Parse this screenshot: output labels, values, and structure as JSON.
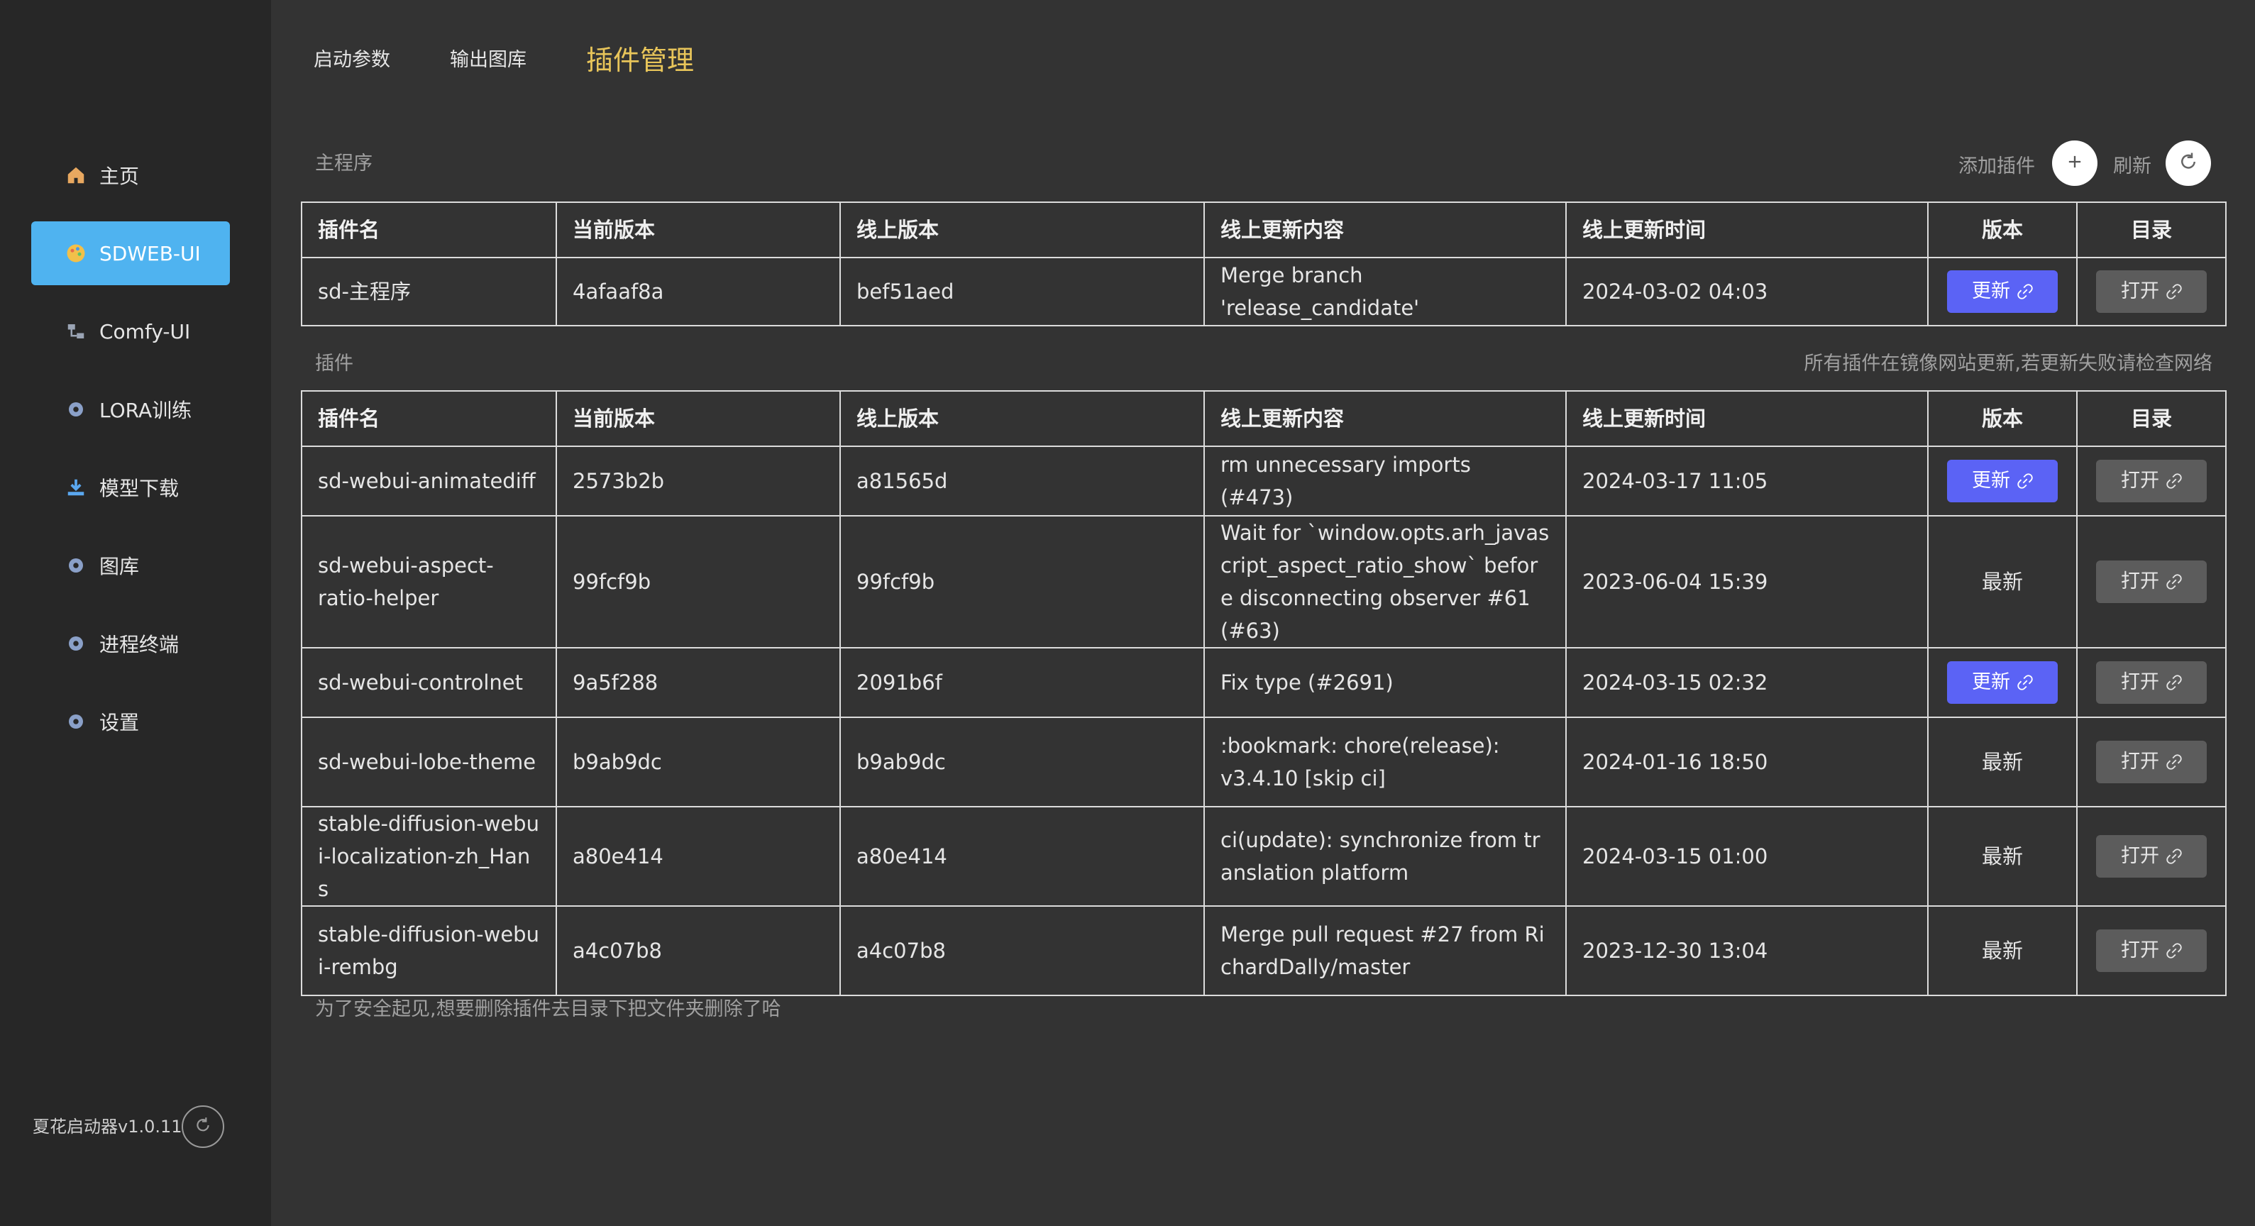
{
  "tabs": [
    {
      "label": "启动参数"
    },
    {
      "label": "输出图库"
    },
    {
      "label": "插件管理"
    }
  ],
  "sidebar": {
    "items": [
      {
        "label": "主页",
        "icon": "home-icon"
      },
      {
        "label": "SDWEB-UI",
        "icon": "palette-icon"
      },
      {
        "label": "Comfy-UI",
        "icon": "network-icon"
      },
      {
        "label": "LORA训练",
        "icon": "gear-icon"
      },
      {
        "label": "模型下载",
        "icon": "download-icon"
      },
      {
        "label": "图库",
        "icon": "gear-icon"
      },
      {
        "label": "进程终端",
        "icon": "gear-icon"
      },
      {
        "label": "设置",
        "icon": "gear-icon"
      }
    ],
    "version": "夏花启动器v1.0.11"
  },
  "main_section": {
    "title": "主程序",
    "add_label": "添加插件",
    "refresh_label": "刷新",
    "columns": [
      "插件名",
      "当前版本",
      "线上版本",
      "线上更新内容",
      "线上更新时间",
      "版本",
      "目录"
    ],
    "row": {
      "name": "sd-主程序",
      "current": "4afaaf8a",
      "online": "bef51aed",
      "content": "Merge branch 'release_candidate'",
      "time": "2024-03-02 04:03",
      "status": "更新",
      "open": "打开"
    }
  },
  "plugin_section": {
    "title": "插件",
    "note": "所有插件在镜像网站更新,若更新失败请检查网络",
    "columns": [
      "插件名",
      "当前版本",
      "线上版本",
      "线上更新内容",
      "线上更新时间",
      "版本",
      "目录"
    ],
    "rows": [
      {
        "name": "sd-webui-animatediff",
        "current": "2573b2b",
        "online": "a81565d",
        "content": "rm unnecessary imports (#473)",
        "time": "2024-03-17 11:05",
        "status": "更新",
        "open": "打开"
      },
      {
        "name": "sd-webui-aspect-ratio-helper",
        "current": "99fcf9b",
        "online": "99fcf9b",
        "content": "Wait for `window.opts.arh_javascript_aspect_ratio_show` before disconnecting observer #61 (#63)",
        "time": "2023-06-04 15:39",
        "status": "最新",
        "open": "打开"
      },
      {
        "name": "sd-webui-controlnet",
        "current": "9a5f288",
        "online": "2091b6f",
        "content": "Fix type (#2691)",
        "time": "2024-03-15 02:32",
        "status": "更新",
        "open": "打开"
      },
      {
        "name": "sd-webui-lobe-theme",
        "current": "b9ab9dc",
        "online": "b9ab9dc",
        "content": ":bookmark: chore(release): v3.4.10 [skip ci]",
        "time": "2024-01-16 18:50",
        "status": "最新",
        "open": "打开"
      },
      {
        "name": "stable-diffusion-webui-localization-zh_Hans",
        "current": "a80e414",
        "online": "a80e414",
        "content": "ci(update): synchronize from translation platform",
        "time": "2024-03-15 01:00",
        "status": "最新",
        "open": "打开"
      },
      {
        "name": "stable-diffusion-webui-rembg",
        "current": "a4c07b8",
        "online": "a4c07b8",
        "content": "Merge pull request #27 from RichardDally/master",
        "time": "2023-12-30 13:04",
        "status": "最新",
        "open": "打开"
      }
    ]
  },
  "footer_note": "为了安全起见,想要删除插件去目录下把文件夹删除了哈",
  "colors": {
    "accent_blue": "#5b63f5",
    "active_nav": "#4fb3f0",
    "active_tab": "#e8c55a",
    "background": "#333333",
    "sidebar": "#272727"
  }
}
